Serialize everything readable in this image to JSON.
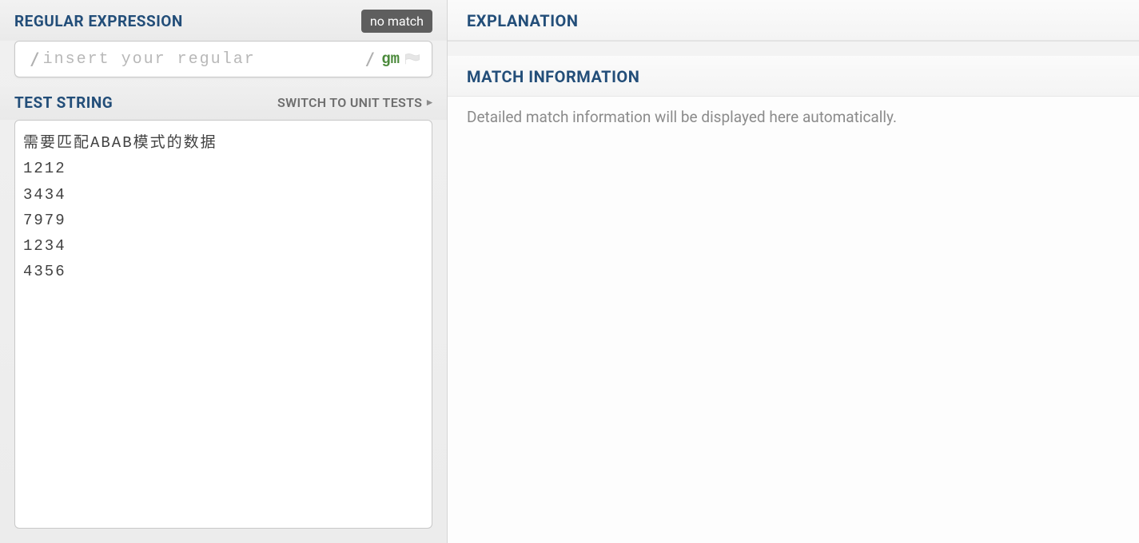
{
  "left": {
    "regex": {
      "title": "REGULAR EXPRESSION",
      "badge": "no match",
      "open_delim": "/",
      "placeholder": "insert your regular",
      "value": "",
      "close_delim": "/",
      "flags": "gm"
    },
    "test": {
      "title": "TEST STRING",
      "switch_label": "SWITCH TO UNIT TESTS",
      "content": "需要匹配ABAB模式的数据\n1212\n3434\n7979\n1234\n4356"
    }
  },
  "right": {
    "explanation": {
      "title": "EXPLANATION"
    },
    "match_info": {
      "title": "MATCH INFORMATION",
      "body": "Detailed match information will be displayed here automatically."
    }
  }
}
